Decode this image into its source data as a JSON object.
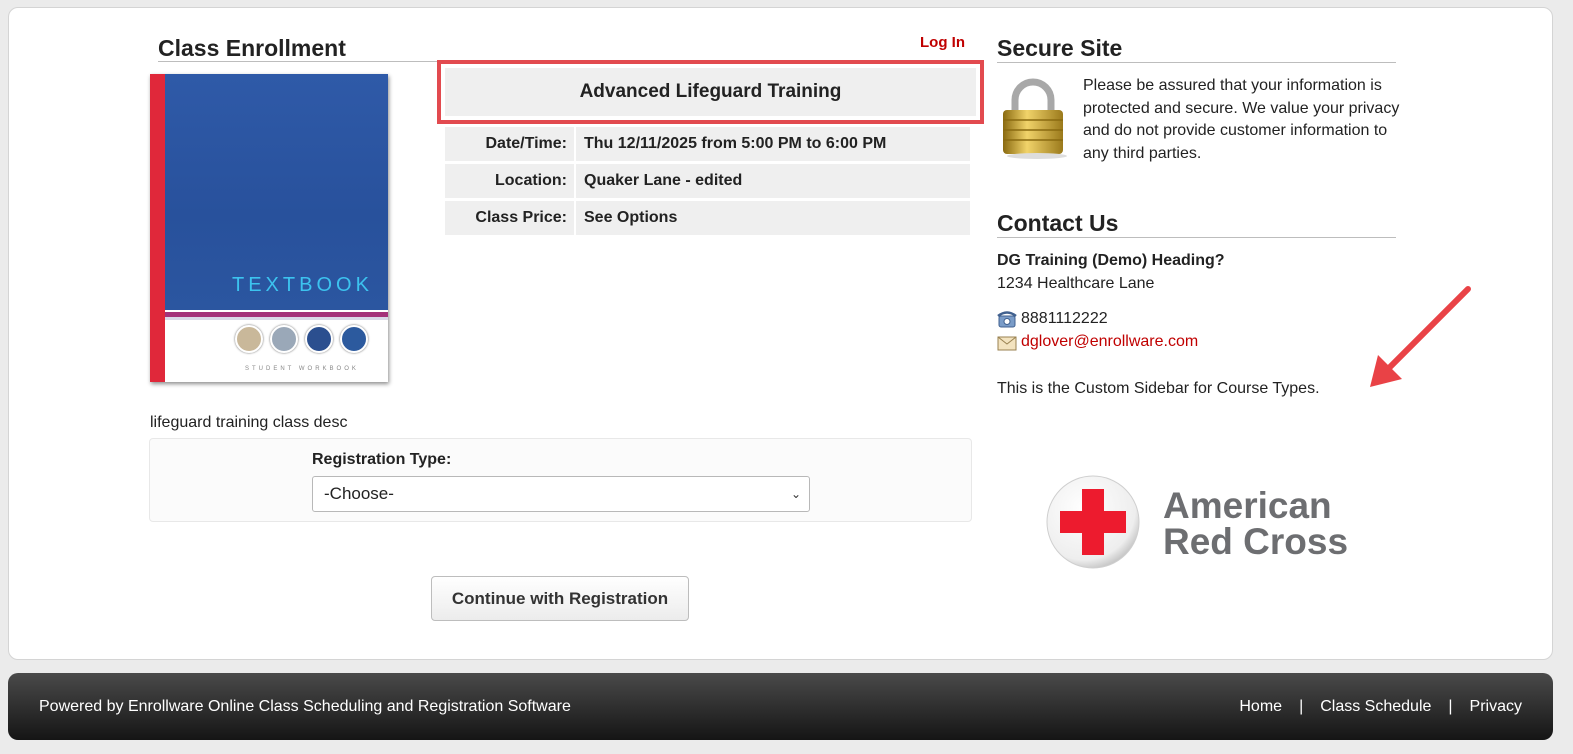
{
  "enrollment": {
    "heading": "Class Enrollment",
    "login_label": "Log In",
    "book_cover_text": "TEXTBOOK",
    "book_subtitle": "STUDENT WORKBOOK",
    "class_title": "Advanced Lifeguard Training",
    "details": [
      {
        "label": "Date/Time:",
        "value": "Thu 12/11/2025 from 5:00 PM to 6:00 PM"
      },
      {
        "label": "Location:",
        "value": "Quaker Lane - edited"
      },
      {
        "label": "Class Price:",
        "value": "See Options"
      }
    ],
    "description": "lifeguard training class desc",
    "registration_type_label": "Registration Type:",
    "registration_type_selected": "-Choose-",
    "continue_label": "Continue with Registration"
  },
  "sidebar": {
    "secure_heading": "Secure Site",
    "secure_text": "Please be assured that your information is protected and secure. We value your privacy and do not provide customer information to any third parties.",
    "contact_heading": "Contact Us",
    "org_name": "DG Training (Demo) Heading?",
    "address": "1234 Healthcare Lane",
    "phone": "8881112222",
    "email": "dglover@enrollware.com",
    "custom_note": "This is the Custom Sidebar for Course Types.",
    "logo_line1": "American",
    "logo_line2": "Red Cross"
  },
  "footer": {
    "powered_by": "Powered by Enrollware Online Class Scheduling and Registration Software",
    "links": [
      "Home",
      "Class Schedule",
      "Privacy"
    ],
    "separator": "|"
  },
  "colors": {
    "link_red": "#c00000",
    "highlight_box": "#e24a4f",
    "arrow": "#e94246",
    "cross_red": "#ed1b2e"
  }
}
